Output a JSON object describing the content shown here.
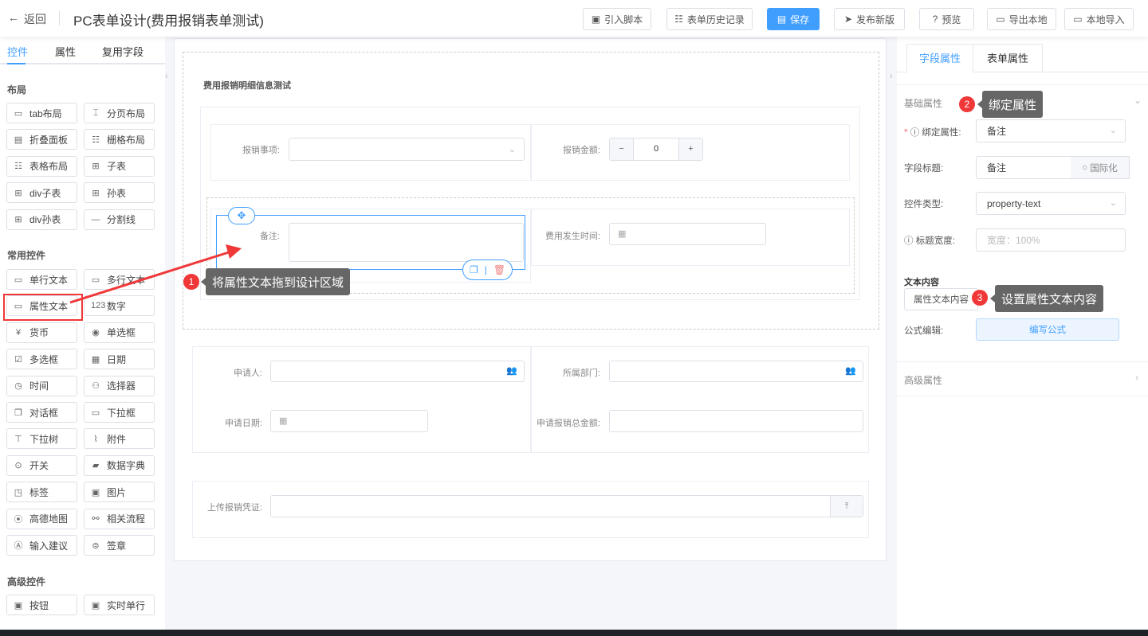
{
  "header": {
    "back": "返回",
    "title": "PC表单设计(费用报销表单测试)",
    "buttons": [
      {
        "label": "引入脚本",
        "icon": "script-icon"
      },
      {
        "label": "表单历史记录",
        "icon": "list-icon"
      },
      {
        "label": "保存",
        "icon": "save-icon"
      },
      {
        "label": "发布新版",
        "icon": "send-icon"
      },
      {
        "label": "预览",
        "icon": "help-icon"
      },
      {
        "label": "导出本地",
        "icon": "folder-icon"
      },
      {
        "label": "本地导入",
        "icon": "folder-open-icon"
      }
    ]
  },
  "left": {
    "tabs": [
      "控件",
      "属性",
      "复用字段"
    ],
    "sections": {
      "layout": "布局",
      "common": "常用控件",
      "advanced": "高级控件"
    },
    "layout_items": [
      "tab布局",
      "分页布局",
      "折叠面板",
      "栅格布局",
      "表格布局",
      "子表",
      "div子表",
      "孙表",
      "div孙表",
      "分割线"
    ],
    "common_items": [
      "单行文本",
      "多行文本",
      "属性文本",
      "数字",
      "货币",
      "单选框",
      "多选框",
      "日期",
      "时间",
      "选择器",
      "对话框",
      "下拉框",
      "下拉树",
      "附件",
      "开关",
      "数据字典",
      "标签",
      "图片",
      "高德地图",
      "相关流程",
      "输入建议",
      "签章"
    ],
    "advanced_items": [
      "按钮",
      "实时单行"
    ]
  },
  "canvas": {
    "group_title": "费用报销明细信息测试",
    "fields": {
      "item": "报销事项:",
      "amount": "报销金额:",
      "amount_value": "0",
      "remark": "备注:",
      "time": "费用发生时间:",
      "applicant": "申请人:",
      "dept": "所属部门:",
      "apply_date": "申请日期:",
      "total": "申请报销总金额:",
      "upload": "上传报销凭证:"
    }
  },
  "right": {
    "tabs": [
      "字段属性",
      "表单属性"
    ],
    "basic": "基础属性",
    "advanced": "高级属性",
    "rows": {
      "bind_label": "绑定属性:",
      "bind_value": "备注",
      "title_label": "字段标题:",
      "title_value": "备注",
      "i18n": "国际化",
      "type_label": "控件类型:",
      "type_value": "property-text",
      "width_label": "标题宽度:",
      "width_placeholder": "宽度：100%",
      "text_content": "文本内容",
      "text_btn": "属性文本内容",
      "formula_label": "公式编辑:",
      "formula_btn": "编写公式"
    }
  },
  "annotations": [
    {
      "num": "1",
      "text": "将属性文本拖到设计区域"
    },
    {
      "num": "2",
      "text": "绑定属性"
    },
    {
      "num": "3",
      "text": "设置属性文本内容"
    }
  ],
  "colors": {
    "accent": "#409eff",
    "annotation": "#f03838"
  }
}
